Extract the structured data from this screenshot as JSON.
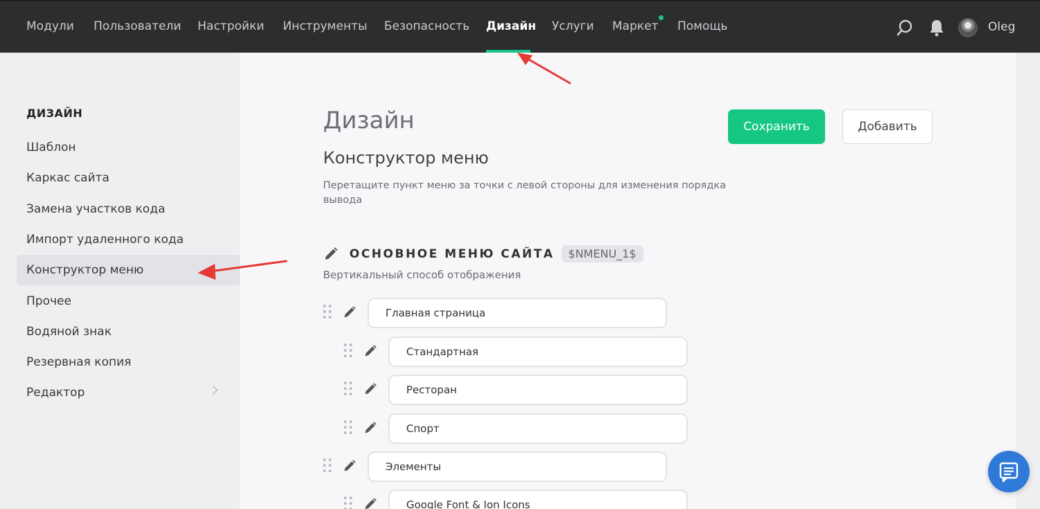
{
  "nav": {
    "items": [
      {
        "label": "Модули"
      },
      {
        "label": "Пользователи"
      },
      {
        "label": "Настройки"
      },
      {
        "label": "Инструменты"
      },
      {
        "label": "Безопасность"
      },
      {
        "label": "Дизайн",
        "active": true
      },
      {
        "label": "Услуги"
      },
      {
        "label": "Маркет"
      },
      {
        "label": "Помощь"
      }
    ],
    "user_name": "Oleg",
    "icons": [
      "search-icon",
      "bell-icon",
      "avatar"
    ]
  },
  "sidebar": {
    "title": "ДИЗАЙН",
    "items": [
      {
        "label": "Шаблон"
      },
      {
        "label": "Каркас сайта"
      },
      {
        "label": "Замена участков кода"
      },
      {
        "label": "Импорт удаленного кода"
      },
      {
        "label": "Конструктор меню",
        "active": true
      },
      {
        "label": "Прочее"
      },
      {
        "label": "Водяной знак"
      },
      {
        "label": "Резервная копия"
      },
      {
        "label": "Редактор"
      }
    ]
  },
  "main": {
    "page_title": "Дизайн",
    "save_label": "Сохранить",
    "add_label": "Добавить",
    "section_title": "Конструктор меню",
    "section_desc": "Перетащите пункт меню за точки с левой стороны для изменения порядка вывода",
    "menu": {
      "name": "ОСНОВНОЕ МЕНЮ САЙТА",
      "code": "$NMENU_1$",
      "display_type": "Вертикальный способ отображения",
      "items": [
        {
          "label": "Главная страница",
          "level": 0
        },
        {
          "label": "Стандартная",
          "level": 1
        },
        {
          "label": "Ресторан",
          "level": 1
        },
        {
          "label": "Спорт",
          "level": 1
        },
        {
          "label": "Элементы",
          "level": 0
        },
        {
          "label": "Google Font & Ion Icons",
          "level": 1
        }
      ]
    }
  },
  "colors": {
    "topbar": "#2b2d2f",
    "accent": "#16c784",
    "chat_button": "#2f79d8",
    "annotation_arrow": "#e53935"
  }
}
